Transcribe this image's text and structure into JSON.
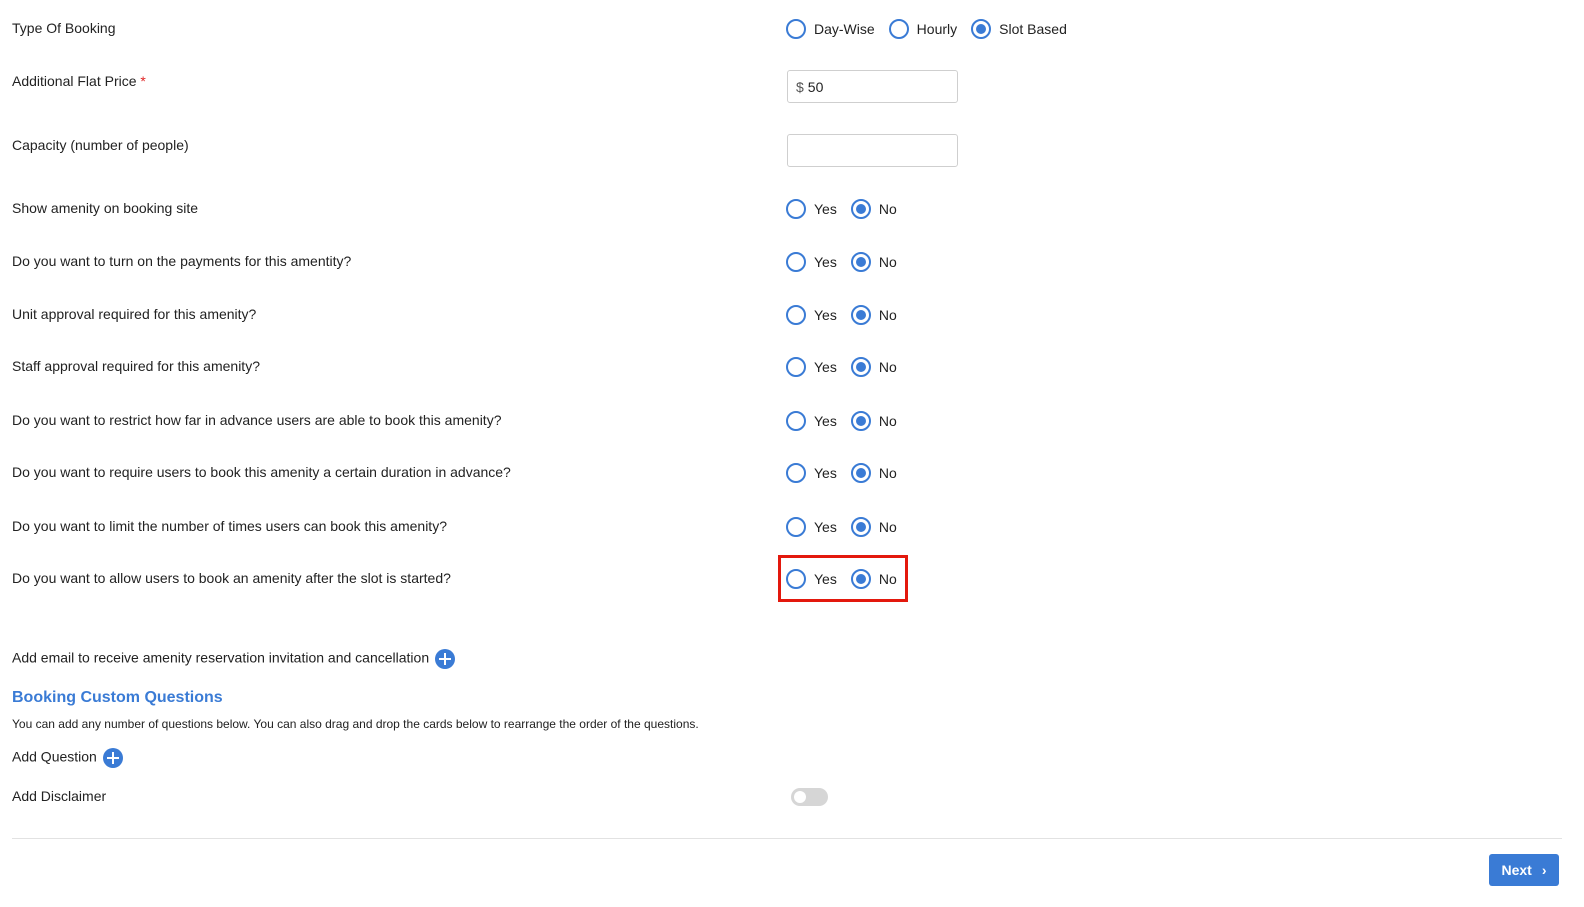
{
  "booking_type": {
    "label": "Type Of Booking",
    "options": [
      "Day-Wise",
      "Hourly",
      "Slot Based"
    ],
    "selected": "Slot Based"
  },
  "flat_price": {
    "label": "Additional Flat Price",
    "required_mark": "*",
    "prefix": "$",
    "value": "50"
  },
  "capacity": {
    "label": "Capacity (number of people)",
    "value": ""
  },
  "yes_label": "Yes",
  "no_label": "No",
  "questions": [
    {
      "label": "Show amenity on booking site",
      "selected": "No"
    },
    {
      "label": "Do you want to turn on the payments for this amentity?",
      "selected": "No"
    },
    {
      "label": "Unit approval required for this amenity?",
      "selected": "No"
    },
    {
      "label": "Staff approval required for this amenity?",
      "selected": "No"
    },
    {
      "label": "Do you want to restrict how far in advance users are able to book this amenity?",
      "selected": "No"
    },
    {
      "label": "Do you want to require users to book this amenity a certain duration in advance?",
      "selected": "No"
    },
    {
      "label": "Do you want to limit the number of times users can book this amenity?",
      "selected": "No"
    },
    {
      "label": "Do you want to allow users to book an amenity after the slot is started?",
      "selected": "No"
    }
  ],
  "add_email_label": "Add email to receive amenity reservation invitation and cancellation",
  "custom_questions": {
    "title": "Booking Custom Questions",
    "description": "You can add any number of questions below. You can also drag and drop the cards below to rearrange the order of the questions.",
    "add_question_label": "Add Question"
  },
  "disclaimer": {
    "label": "Add Disclaimer",
    "enabled": false
  },
  "next_label": "Next",
  "colors": {
    "accent": "#3a7bd5",
    "highlight": "#e3180d",
    "required": "#e02424"
  }
}
